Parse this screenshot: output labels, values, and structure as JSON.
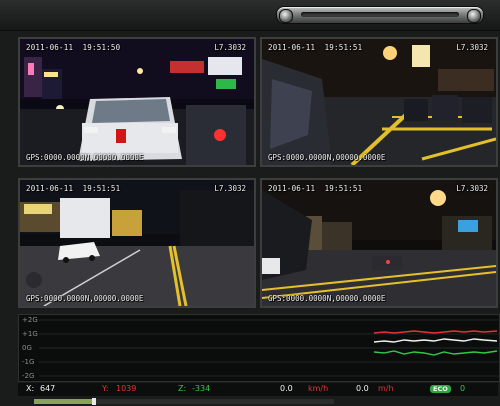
{
  "views": [
    {
      "timestamp": "2011-06-11  19:51:50",
      "camera": "L7.3032",
      "gps": "GPS:0000.0000N,00000.0000E"
    },
    {
      "timestamp": "2011-06-11  19:51:51",
      "camera": "L7.3032",
      "gps": "GPS:0000.0000N,00000.0000E"
    },
    {
      "timestamp": "2011-06-11  19:51:51",
      "camera": "L7.3032",
      "gps": "GPS:0000.0000N,00000.0000E"
    },
    {
      "timestamp": "2011-06-11  19:51:51",
      "camera": "L7.3032",
      "gps": "GPS:0000.0000N,00000.0000E"
    }
  ],
  "gsensor": {
    "axis_labels": [
      "+2G",
      "+1G",
      "0G",
      "-1G",
      "-2G"
    ]
  },
  "status": {
    "x_label": "X:",
    "x_value": "647",
    "y_label": "Y:",
    "y_value": "1039",
    "z_label": "Z:",
    "z_value": "-334",
    "speed_kmh_value": "0.0",
    "speed_kmh_unit": "km/h",
    "speed_mh_value": "0.0",
    "speed_mh_unit": "m/h",
    "eco_badge": "ECO",
    "eco_value": "0"
  },
  "playback": {
    "progress": 0.2
  },
  "colors": {
    "x": "#f2f2f2",
    "y": "#e23434",
    "z": "#34c84a",
    "eco": "#2aa843"
  }
}
